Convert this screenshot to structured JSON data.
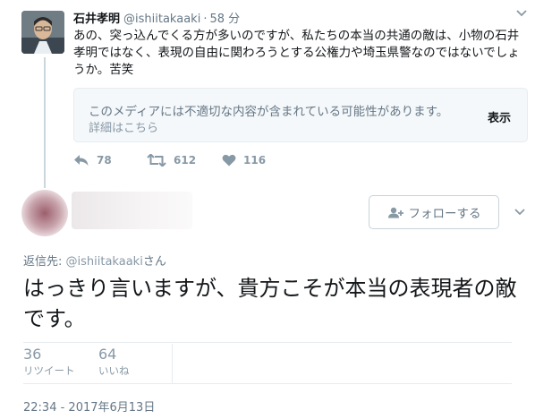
{
  "tweet1": {
    "name": "石井孝明",
    "handle": "@ishiitakaaki",
    "separator": "·",
    "time": "58 分",
    "text": "あの、突っ込んでくる方が多いのですが、私たちの本当の共通の敵は、小物の石井孝明ではなく、表現の自由に関わろうとする公権力や埼玉県警なのではないでしょうか。苦笑",
    "media_warning": {
      "message": "このメディアには不適切な内容が含まれている可能性があります。",
      "details": "詳細はこちら",
      "show": "表示"
    },
    "actions": {
      "reply_count": "78",
      "retweet_count": "612",
      "like_count": "116"
    }
  },
  "tweet2": {
    "follow_label": "フォローする",
    "reply_to_prefix": "返信先: ",
    "reply_to_handle": "@ishiitakaaki",
    "reply_to_suffix": "さん",
    "text": "はっきり言いますが、貴方こそが本当の表現者の敵です。",
    "stats": {
      "retweets": "36",
      "retweets_label": "リツイート",
      "likes": "64",
      "likes_label": "いいね"
    },
    "timestamp": "22:34 - 2017年6月13日"
  },
  "colors": {
    "text_primary": "#14171a",
    "text_secondary": "#657786",
    "text_muted": "#8899a6",
    "border": "#e6ecf0",
    "thread_line": "#ccd6dd"
  }
}
